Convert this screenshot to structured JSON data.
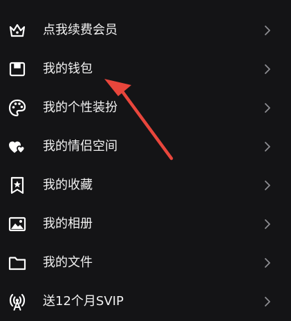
{
  "menu": {
    "items": [
      {
        "label": "点我续费会员",
        "icon": "crown-icon"
      },
      {
        "label": "我的钱包",
        "icon": "wallet-icon"
      },
      {
        "label": "我的个性装扮",
        "icon": "palette-icon"
      },
      {
        "label": "我的情侣空间",
        "icon": "hearts-icon"
      },
      {
        "label": "我的收藏",
        "icon": "bookmark-star-icon"
      },
      {
        "label": "我的相册",
        "icon": "photo-album-icon"
      },
      {
        "label": "我的文件",
        "icon": "folder-icon"
      },
      {
        "label": "送12个月SVIP",
        "icon": "broadcast-icon"
      }
    ]
  },
  "colors": {
    "background": "#141416",
    "text": "#f2f2f2",
    "chevron": "#8e8e93",
    "annotation_arrow": "#e8463c"
  }
}
